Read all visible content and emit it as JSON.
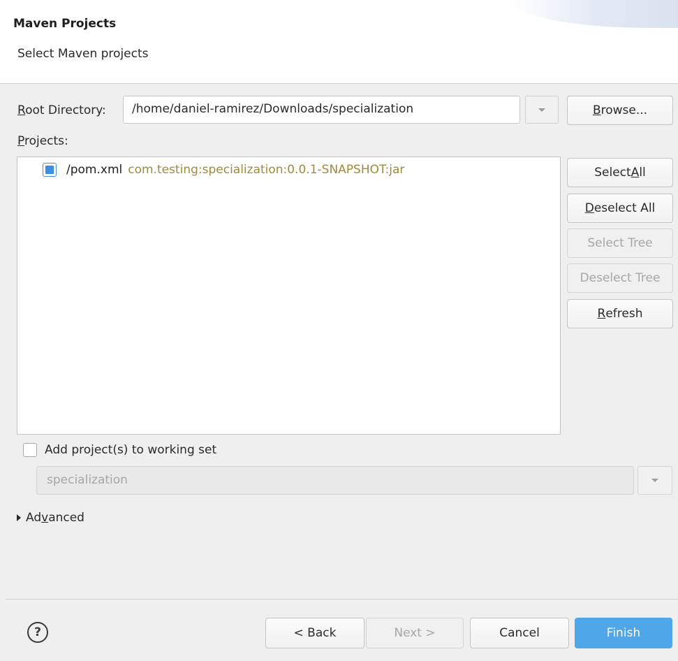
{
  "header": {
    "title": "Maven Projects",
    "subtitle": "Select Maven projects"
  },
  "root_directory": {
    "label_mnemonic": "R",
    "label_rest": "oot Directory:",
    "value": "/home/daniel-ramirez/Downloads/specialization",
    "browse_mnemonic": "B",
    "browse_rest": "rowse..."
  },
  "projects": {
    "label_mnemonic": "P",
    "label_rest": "rojects:",
    "items": [
      {
        "name": "/pom.xml",
        "gav": "com.testing:specialization:0.0.1-SNAPSHOT:jar",
        "checked": true
      }
    ]
  },
  "side_buttons": {
    "select_all_prefix": "Select ",
    "select_all_mnemonic": "A",
    "select_all_suffix": "ll",
    "deselect_all_mnemonic": "D",
    "deselect_all_rest": "eselect All",
    "select_tree": "Select Tree",
    "deselect_tree": "Deselect Tree",
    "refresh_mnemonic": "R",
    "refresh_rest": "efresh"
  },
  "working_set": {
    "checkbox_label": "Add project(s) to working set",
    "checked": false,
    "value": "specialization"
  },
  "advanced": {
    "prefix": "Ad",
    "mnemonic": "v",
    "suffix": "anced"
  },
  "footer": {
    "help_glyph": "?",
    "back": "< Back",
    "next": "Next >",
    "cancel": "Cancel",
    "finish": "Finish"
  },
  "colors": {
    "primary_button": "#4fa6e8",
    "gav_text": "#a18a3a",
    "checkbox_fill": "#3b8fe0"
  }
}
